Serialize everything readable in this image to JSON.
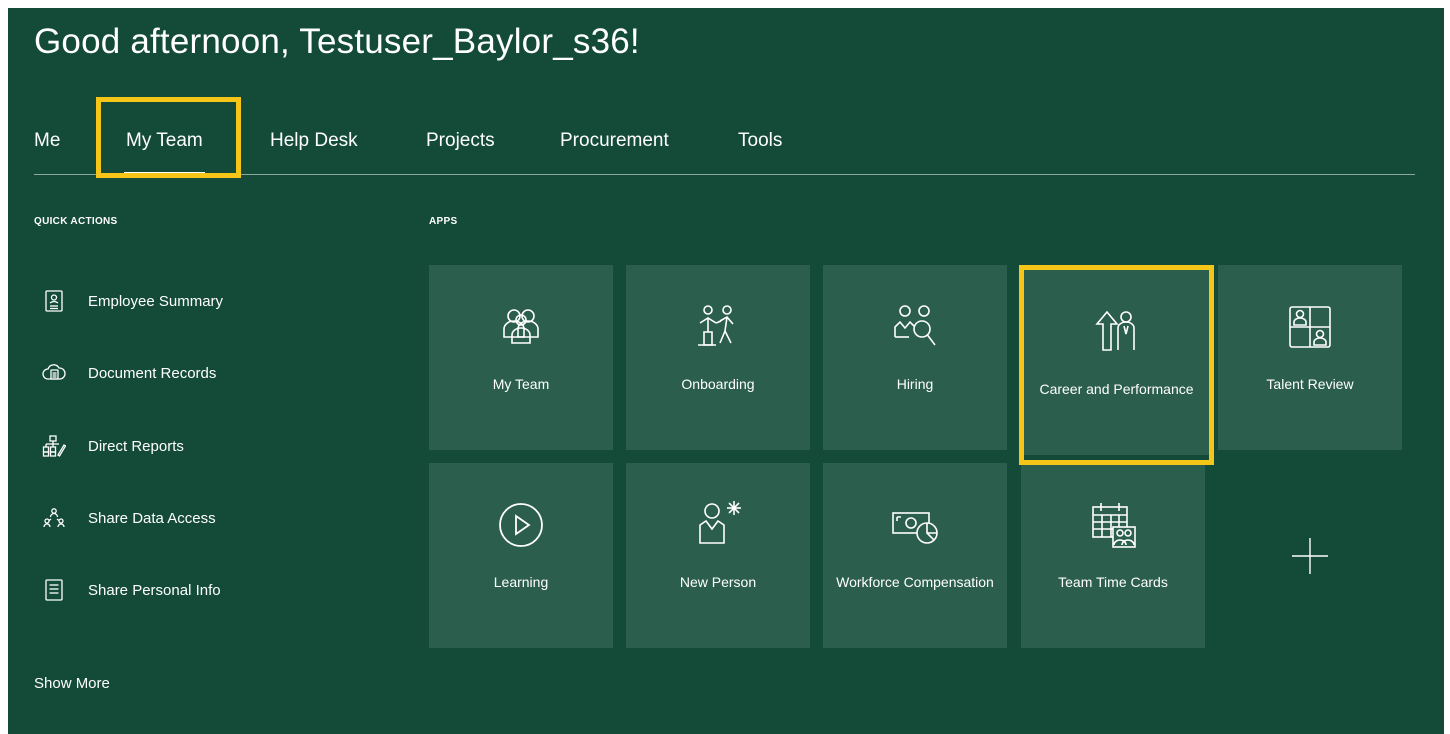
{
  "greeting": "Good afternoon, Testuser_Baylor_s36!",
  "tabs": [
    {
      "label": "Me"
    },
    {
      "label": "My Team",
      "active": true
    },
    {
      "label": "Help Desk"
    },
    {
      "label": "Projects"
    },
    {
      "label": "Procurement"
    },
    {
      "label": "Tools"
    }
  ],
  "quick_actions": {
    "heading": "QUICK ACTIONS",
    "items": [
      {
        "label": "Employee Summary",
        "icon": "id-badge-icon"
      },
      {
        "label": "Document Records",
        "icon": "cloud-document-icon"
      },
      {
        "label": "Direct Reports",
        "icon": "org-chart-icon"
      },
      {
        "label": "Share Data Access",
        "icon": "people-hierarchy-icon"
      },
      {
        "label": "Share Personal Info",
        "icon": "document-lines-icon"
      }
    ],
    "show_more": "Show More"
  },
  "apps": {
    "heading": "APPS",
    "tiles": [
      {
        "label": "My Team",
        "icon": "team-icon"
      },
      {
        "label": "Onboarding",
        "icon": "onboarding-icon"
      },
      {
        "label": "Hiring",
        "icon": "hiring-icon"
      },
      {
        "label": "Career and Performance",
        "icon": "career-icon"
      },
      {
        "label": "Talent Review",
        "icon": "talent-review-icon"
      },
      {
        "label": "Learning",
        "icon": "play-circle-icon"
      },
      {
        "label": "New Person",
        "icon": "new-person-icon"
      },
      {
        "label": "Workforce Compensation",
        "icon": "compensation-icon"
      },
      {
        "label": "Team Time Cards",
        "icon": "calendar-team-icon"
      },
      {
        "label": "",
        "icon": "plus-icon"
      }
    ]
  },
  "colors": {
    "background": "#134a38",
    "tile": "#2b5e4c",
    "highlight": "#f5c518"
  }
}
